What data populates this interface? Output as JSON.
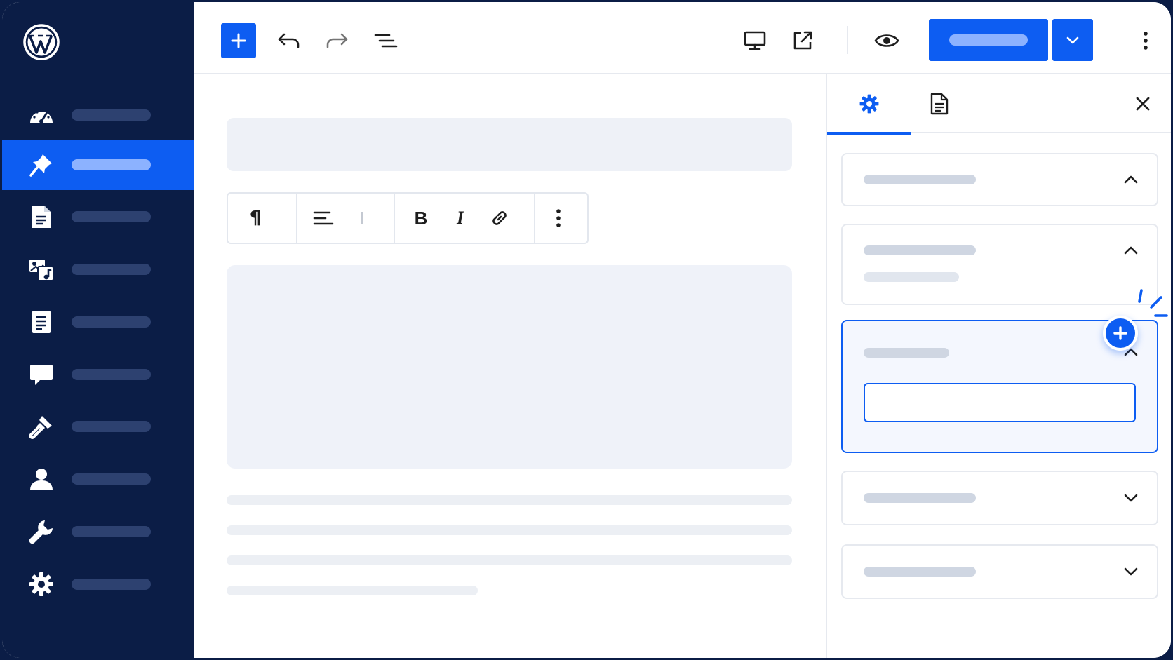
{
  "sidebar": {
    "logo": "wordpress-logo",
    "items": [
      {
        "icon": "dashboard-icon",
        "active": false
      },
      {
        "icon": "pin-icon",
        "active": true
      },
      {
        "icon": "page-icon",
        "active": false
      },
      {
        "icon": "media-icon",
        "active": false
      },
      {
        "icon": "document-icon",
        "active": false
      },
      {
        "icon": "comment-icon",
        "active": false
      },
      {
        "icon": "brush-icon",
        "active": false
      },
      {
        "icon": "user-icon",
        "active": false
      },
      {
        "icon": "wrench-icon",
        "active": false
      },
      {
        "icon": "gear-icon",
        "active": false
      }
    ]
  },
  "toolbar": {
    "tools": [
      "plus-icon",
      "undo-icon",
      "redo-icon",
      "list-view-icon"
    ],
    "actions": [
      "desktop-preview-icon",
      "external-link-icon",
      "eye-icon"
    ],
    "more": "kebab-icon"
  },
  "block_toolbar": {
    "paragraph_glyph": "¶",
    "bold_glyph": "B",
    "italic_glyph": "I"
  },
  "panel": {
    "tabs": [
      "gear-icon",
      "document-icon"
    ],
    "active_tab": 0,
    "sections": [
      {
        "expanded": true,
        "selected": false
      },
      {
        "expanded": true,
        "selected": false
      },
      {
        "expanded": true,
        "selected": true
      },
      {
        "expanded": false,
        "selected": false
      },
      {
        "expanded": false,
        "selected": false
      }
    ]
  },
  "colors": {
    "sidebar": "#0b1d46",
    "accent": "#0d5df2",
    "placeholder": "#eef1f7"
  }
}
